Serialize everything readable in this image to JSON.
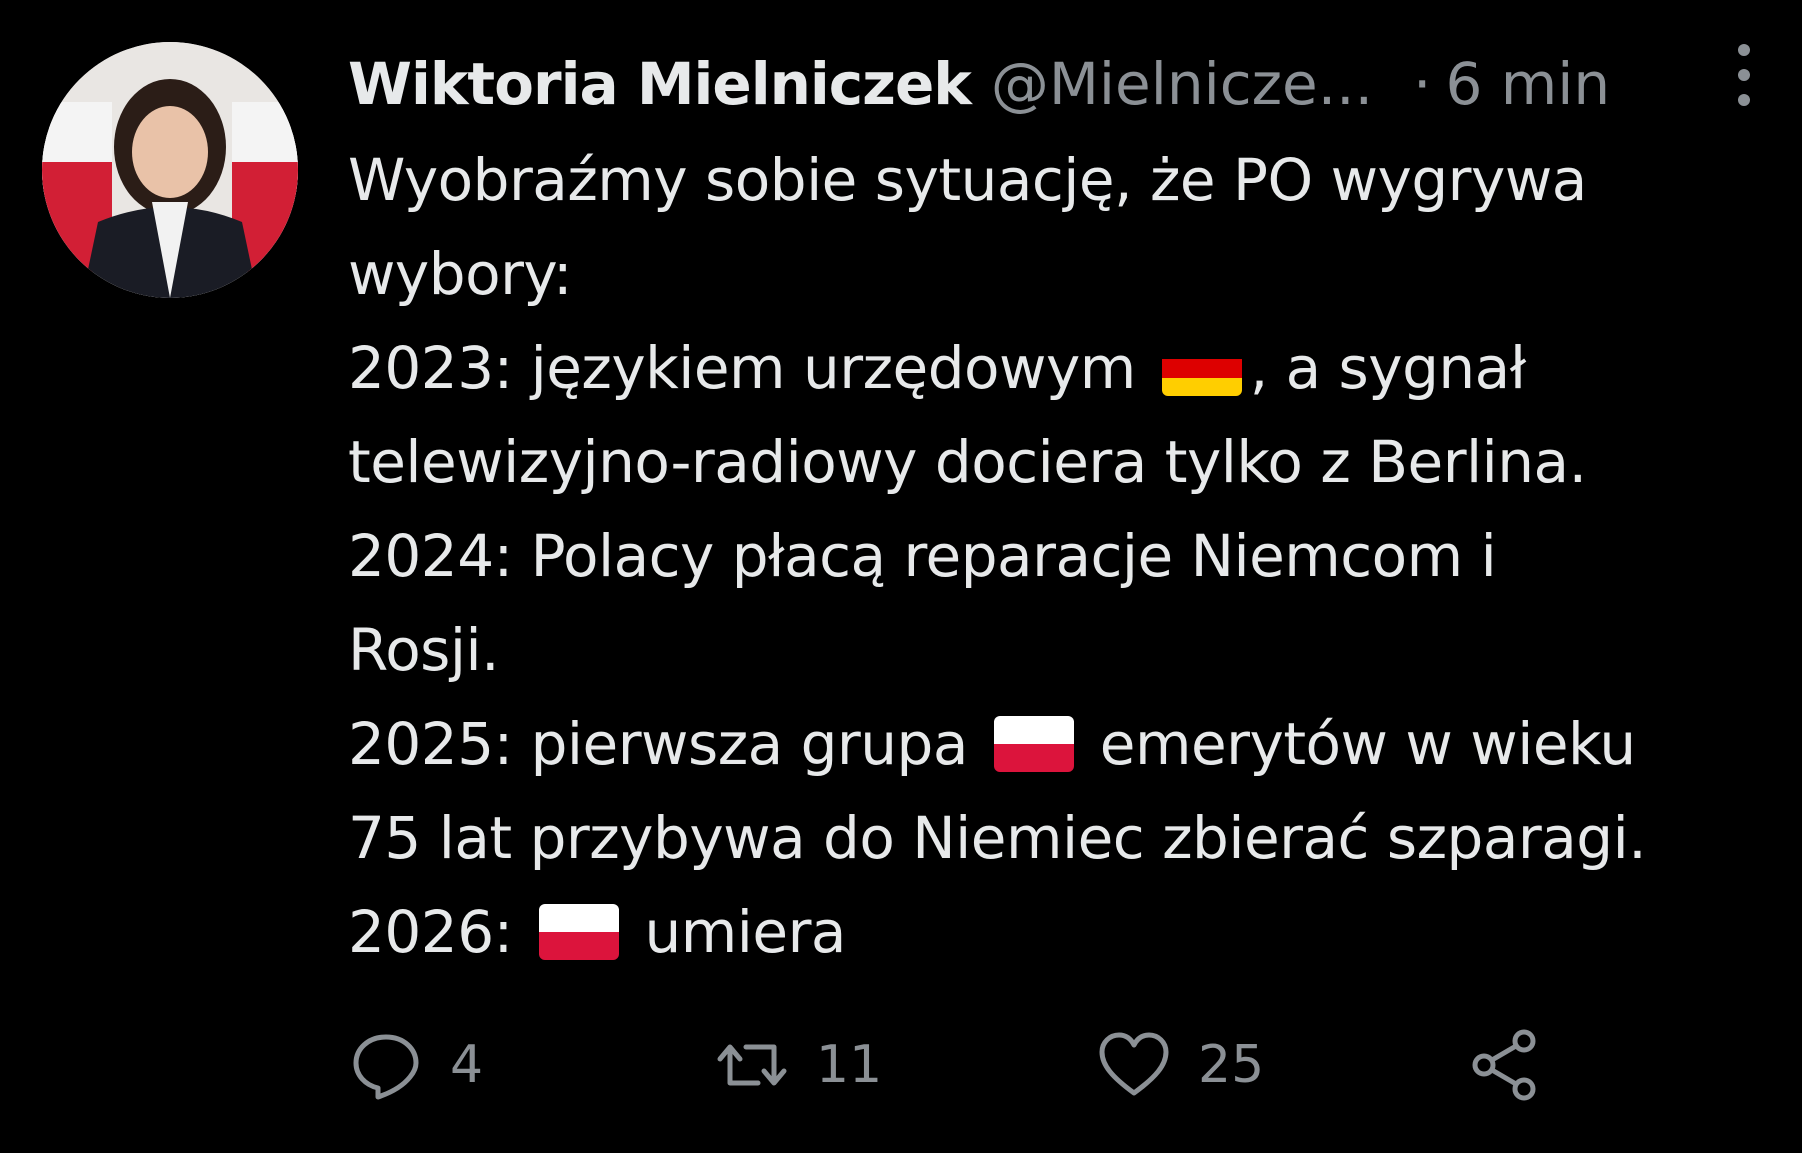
{
  "tweet": {
    "author_name": "Wiktoria Mielniczek",
    "handle": "@Mielnicze...",
    "separator": "·",
    "time": "6 min",
    "text": {
      "line1": "Wyobraźmy sobie sytuację, że PO wygrywa",
      "line2": "wybory:",
      "line3_a": "2023: językiem urzędowym",
      "line3_b": ", a sygnał",
      "line4": "telewizyjno-radiowy dociera tylko z Berlina.",
      "line5": "2024: Polacy płacą reparacje Niemcom i",
      "line6": "Rosji.",
      "line7_a": "2025: pierwsza grupa",
      "line7_b": "emerytów w wieku",
      "line8": "75 lat przybywa do Niemiec zbierać szparagi.",
      "line9_a": "2026:",
      "line9_b": "umiera"
    },
    "flags": {
      "german_flag": "german-flag-icon",
      "polish_flag": "polish-flag-icon"
    },
    "actions": {
      "reply_count": "4",
      "retweet_count": "11",
      "like_count": "25"
    }
  },
  "colors": {
    "background": "#000000",
    "text": "#e7e9ea",
    "muted": "#8b9095",
    "poland_red": "#dc143c",
    "germany_black": "#000000",
    "germany_red": "#dd0000",
    "germany_gold": "#ffce00"
  }
}
